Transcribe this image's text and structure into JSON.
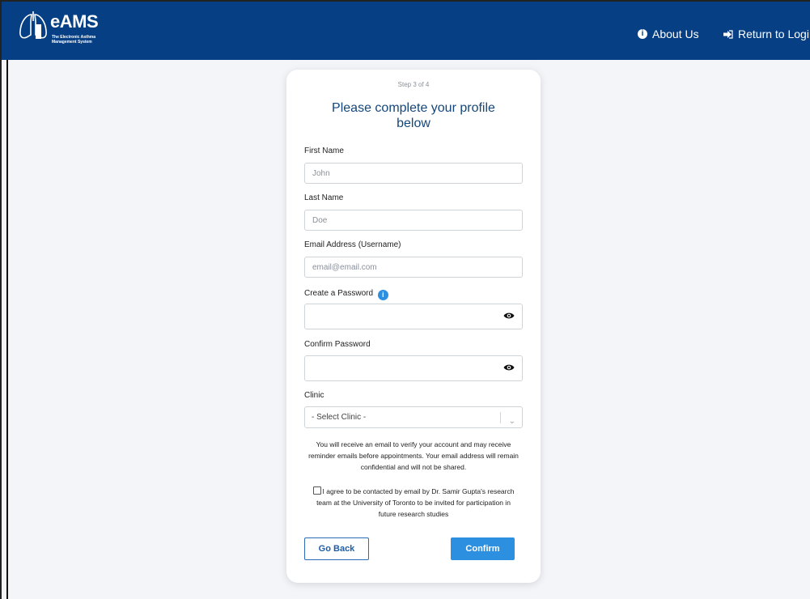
{
  "header": {
    "brand": "eAMS",
    "brand_sub": "The Electronic Asthma Management System",
    "nav": [
      {
        "label": "About Us",
        "icon": "info-circle-icon"
      },
      {
        "label": "Return to Login",
        "icon": "sign-in-arrow-icon"
      }
    ]
  },
  "form": {
    "step": "Step 3 of 4",
    "title": "Please complete your profile below",
    "fields": {
      "first_name": {
        "label": "First Name",
        "placeholder": "John"
      },
      "last_name": {
        "label": "Last Name",
        "placeholder": "Doe"
      },
      "email": {
        "label": "Email Address (Username)",
        "placeholder": "email@email.com"
      },
      "password": {
        "label": "Create a Password"
      },
      "confirm": {
        "label": "Confirm Password"
      },
      "clinic": {
        "label": "Clinic",
        "selected": "- Select Clinic -"
      }
    },
    "note": "You will receive an email to verify your account and may receive reminder emails before appointments. Your email address will remain confidential and will not be shared.",
    "agree": "I agree to be contacted by email by Dr. Samir Gupta's research team at the University of Toronto to be invited for participation in future research studies",
    "back_label": "Go Back",
    "confirm_label": "Confirm"
  },
  "colors": {
    "header": "#063f84",
    "accent": "#2d8fe0",
    "title": "#14467a"
  }
}
